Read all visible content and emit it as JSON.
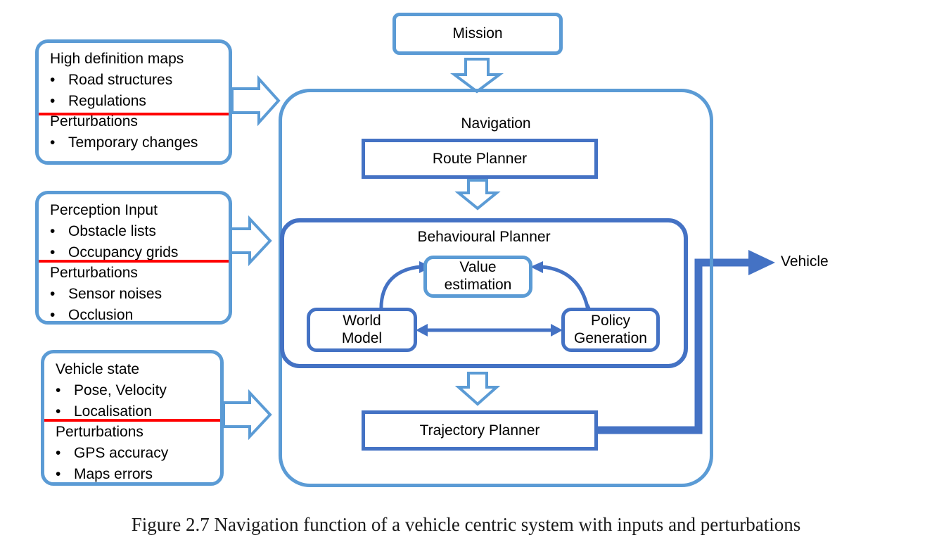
{
  "figure": {
    "caption": "Figure 2.7 Navigation function of a vehicle centric system with inputs and perturbations"
  },
  "inputs": [
    {
      "id": "high-definition-maps",
      "title": "High definition maps",
      "items": [
        "Road structures",
        "Regulations"
      ],
      "divider_label": "Perturbations",
      "perturbations": [
        "Temporary changes"
      ]
    },
    {
      "id": "perception-input",
      "title": "Perception Input",
      "items": [
        "Obstacle lists",
        "Occupancy grids"
      ],
      "divider_label": "Perturbations",
      "perturbations": [
        "Sensor noises",
        "Occlusion"
      ]
    },
    {
      "id": "vehicle-state",
      "title": "Vehicle state",
      "items": [
        "Pose, Velocity",
        "Localisation"
      ],
      "divider_label": "Perturbations",
      "perturbations": [
        "GPS accuracy",
        "Maps errors"
      ]
    }
  ],
  "mission": {
    "label": "Mission"
  },
  "navigation": {
    "label": "Navigation",
    "route_planner": "Route Planner",
    "trajectory_planner": "Trajectory Planner"
  },
  "behavioural_planner": {
    "label": "Behavioural Planner",
    "value_estimation_line1": "Value",
    "value_estimation_line2": "estimation",
    "world_model_line1": "World",
    "world_model_line2": "Model",
    "policy_generation_line1": "Policy",
    "policy_generation_line2": "Generation"
  },
  "output": {
    "vehicle": "Vehicle"
  },
  "bullet_glyph": "•",
  "colors": {
    "light_blue": "#5B9BD5",
    "dark_blue": "#4472C4",
    "divider_red": "#FF0000",
    "text": "#000000",
    "background": "#FFFFFF"
  }
}
